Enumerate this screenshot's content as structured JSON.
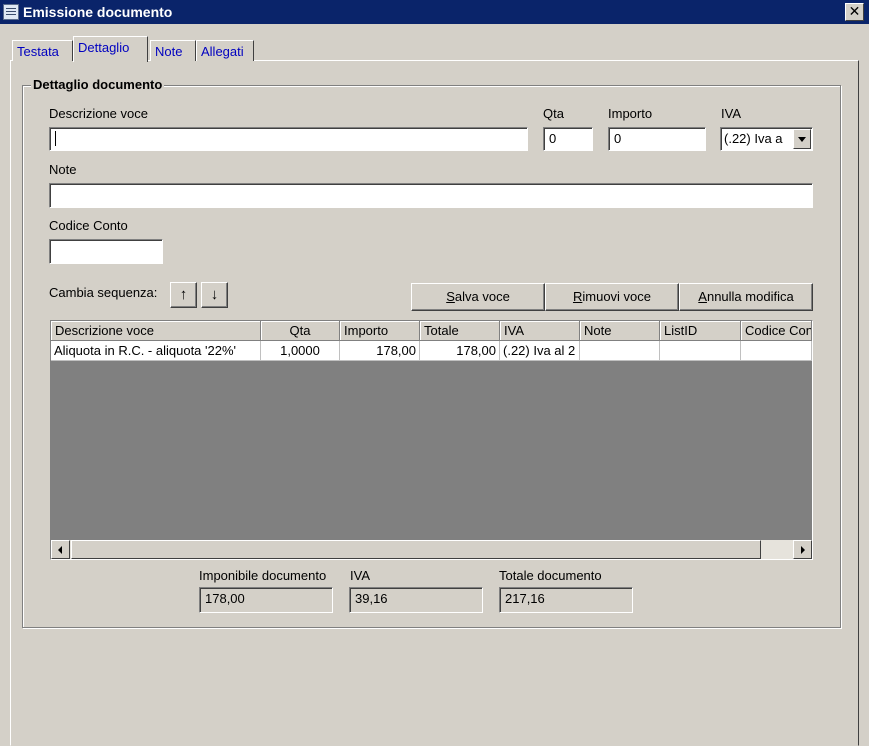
{
  "window": {
    "title": "Emissione documento",
    "close_label": "✕"
  },
  "tabs": [
    {
      "label": "Testata"
    },
    {
      "label": "Dettaglio",
      "active": true
    },
    {
      "label": "Note"
    },
    {
      "label": "Allegati"
    }
  ],
  "group": {
    "title": "Dettaglio documento",
    "descrizione": {
      "label": "Descrizione voce",
      "value": ""
    },
    "qta": {
      "label": "Qta",
      "value": "0"
    },
    "importo": {
      "label": "Importo",
      "value": "0"
    },
    "iva": {
      "label": "IVA",
      "value": "(.22) Iva a"
    },
    "note": {
      "label": "Note",
      "value": ""
    },
    "codice_conto": {
      "label": "Codice Conto",
      "value": ""
    },
    "cambia_sequenza": {
      "label": "Cambia sequenza:",
      "up": "↑",
      "down": "↓"
    },
    "buttons": {
      "salva_voce": {
        "mnemonic": "S",
        "rest": "alva voce"
      },
      "rimuovi_voce": {
        "mnemonic": "R",
        "rest": "imuovi voce"
      },
      "annulla_modifica": {
        "mnemonic": "A",
        "rest": "nnulla modifica"
      }
    }
  },
  "grid": {
    "columns": [
      "Descrizione voce",
      "Qta",
      "Importo",
      "Totale",
      "IVA",
      "Note",
      "ListID",
      "Codice Con"
    ],
    "rows": [
      [
        "Aliquota in R.C. - aliquota '22%'",
        "1,0000",
        "178,00",
        "178,00",
        "(.22) Iva al 2",
        "",
        "",
        ""
      ]
    ]
  },
  "totals": {
    "imponibile": {
      "label": "Imponibile documento",
      "value": "178,00"
    },
    "iva": {
      "label": "IVA",
      "value": "39,16"
    },
    "totale": {
      "label": "Totale documento",
      "value": "217,16"
    }
  }
}
